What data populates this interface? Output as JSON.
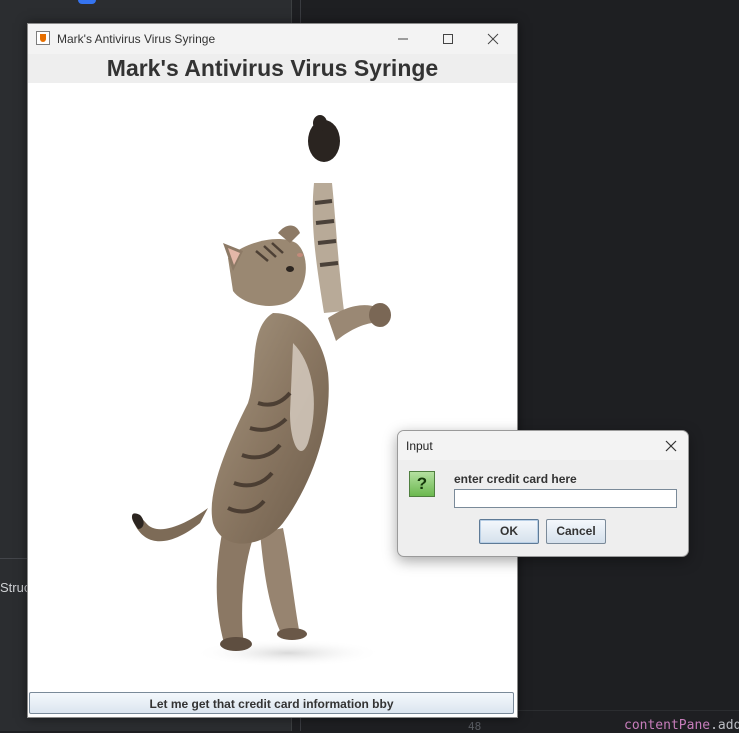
{
  "ide": {
    "side_label": "Struc",
    "line_number": "48",
    "code_identifier": "contentPane",
    "code_rest": ".add"
  },
  "window": {
    "title": "Mark's Antivirus Virus Syringe",
    "heading": "Mark's Antivirus Virus Syringe",
    "bottom_button_label": "Let me get that credit card information bby"
  },
  "dialog": {
    "title": "Input",
    "prompt": "enter credit card here",
    "input_value": "",
    "ok_label": "OK",
    "cancel_label": "Cancel"
  }
}
